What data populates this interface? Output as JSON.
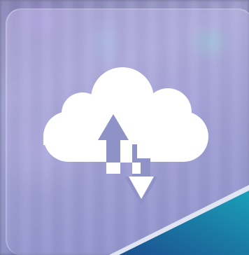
{
  "icon": {
    "name": "cloud-upload-download-icon",
    "color": "#ffffff"
  },
  "corner_accent": {
    "name": "corner-triangle",
    "colors": [
      "#1c5f9e",
      "#1a8fb0"
    ]
  }
}
